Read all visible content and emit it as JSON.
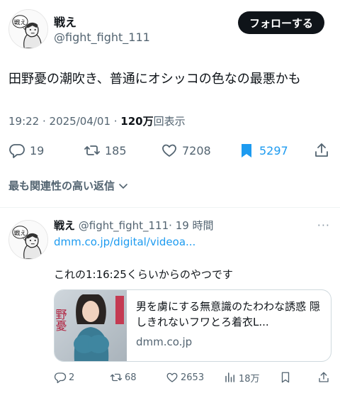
{
  "tweet": {
    "author_name": "戦え",
    "author_handle": "@fight_fight_111",
    "follow_label": "フォローする",
    "text": "田野憂の潮吹き、普通にオシッコの色なの最悪かも",
    "time": "19:22 · 2025/04/01 · ",
    "views_count": "120万",
    "views_label": "回表示",
    "replies": "19",
    "retweets": "185",
    "likes": "7208",
    "bookmarks": "5297",
    "avatar_speech": "戦え"
  },
  "sort_label": "最も関連性の高い返信",
  "reply": {
    "author_name": "戦え",
    "author_handle": "@fight_fight_111",
    "time": "· 19 時間",
    "more": "···",
    "link": "dmm.co.jp/digital/videoa...",
    "text": "これの1:16:25くらいからのやつです",
    "card_title": "男を虜にする無意識のたわわな誘惑 隠しきれないフワとろ着衣L...",
    "card_domain": "dmm.co.jp",
    "card_thumb_text": "野憂",
    "replies": "2",
    "retweets": "68",
    "likes": "2653",
    "views": "18万"
  },
  "colors": {
    "accent": "#1d9bf0",
    "text": "#0f1419",
    "secondary": "#536471",
    "border": "#cfd9de"
  },
  "icons": [
    "reply-icon",
    "retweet-icon",
    "like-icon",
    "bookmark-icon",
    "share-icon",
    "chevron-down-icon",
    "views-icon"
  ]
}
